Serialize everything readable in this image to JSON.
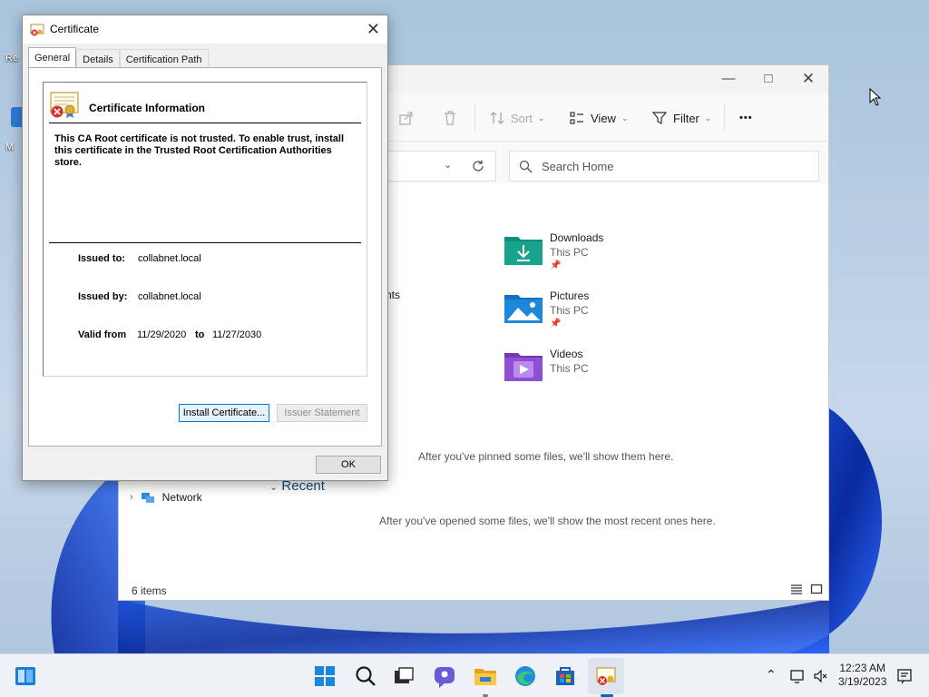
{
  "desktop": {
    "icon_labels": [
      "Re",
      "M"
    ]
  },
  "explorer": {
    "toolbar": {
      "sort_label": "Sort",
      "view_label": "View",
      "filter_label": "Filter",
      "more_label": "•••"
    },
    "search": {
      "placeholder": "Search Home"
    },
    "partial_text": "nts",
    "quick_access": [
      {
        "name": "Downloads",
        "location": "This PC",
        "pinned": true,
        "icon": "downloads-folder-icon",
        "color": "#1aa38c"
      },
      {
        "name": "Pictures",
        "location": "This PC",
        "pinned": true,
        "icon": "pictures-folder-icon",
        "color": "#1e88d8"
      },
      {
        "name": "Videos",
        "location": "This PC",
        "pinned": false,
        "icon": "videos-folder-icon",
        "color": "#8e4fd1"
      }
    ],
    "favorites_empty": "After you've pinned some files, we'll show them here.",
    "recent_header": "Recent",
    "recent_empty": "After you've opened some files, we'll show the most recent ones here.",
    "nav": {
      "network_label": "Network"
    },
    "status": {
      "item_count": "6 items"
    }
  },
  "certificate": {
    "window_title": "Certificate",
    "tabs": [
      "General",
      "Details",
      "Certification Path"
    ],
    "active_tab": "General",
    "info_heading": "Certificate Information",
    "warning": "This CA Root certificate is not trusted. To enable trust, install this certificate in the Trusted Root Certification Authorities store.",
    "issued_to_label": "Issued to:",
    "issued_to": "collabnet.local",
    "issued_by_label": "Issued by:",
    "issued_by": "collabnet.local",
    "valid_from_label": "Valid from",
    "valid_from": "11/29/2020",
    "to_label": "to",
    "valid_to": "11/27/2030",
    "install_button": "Install Certificate...",
    "issuer_button": "Issuer Statement",
    "ok_button": "OK"
  },
  "taskbar": {
    "time": "12:23 AM",
    "date": "3/19/2023"
  }
}
